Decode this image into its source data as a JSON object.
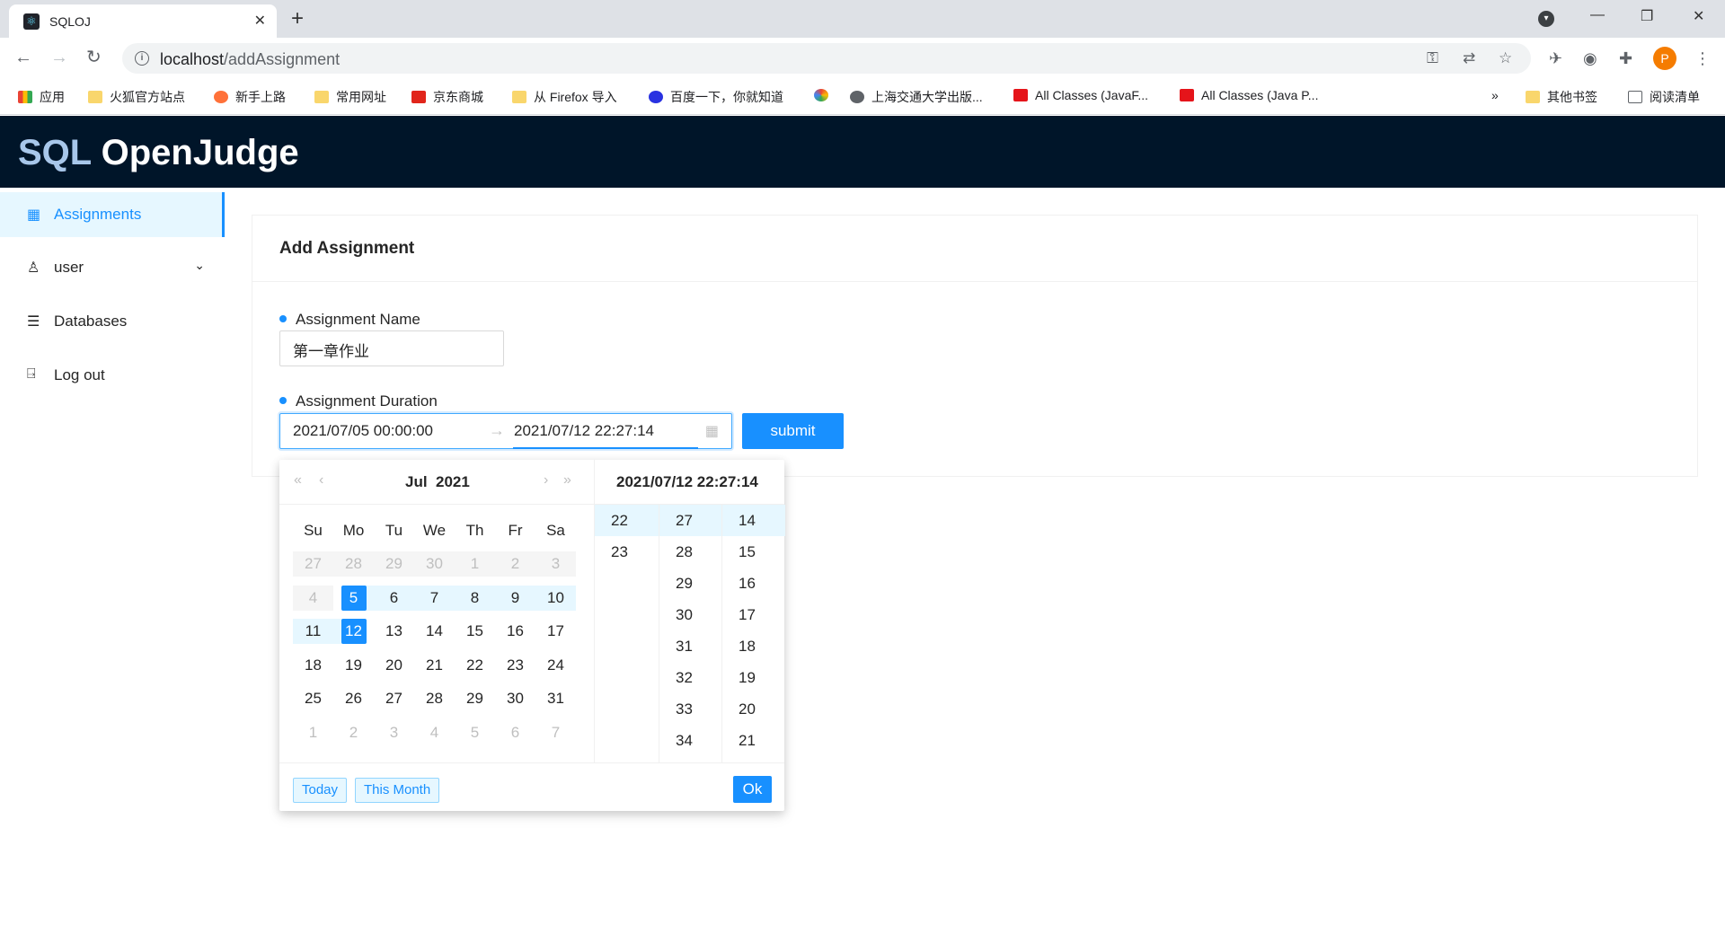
{
  "browser": {
    "tab_title": "SQLOJ",
    "url_host": "localhost",
    "url_path": "/addAssignment",
    "profile_initial": "P",
    "bookmarks": [
      {
        "label": "应用"
      },
      {
        "label": "火狐官方站点"
      },
      {
        "label": "新手上路"
      },
      {
        "label": "常用网址"
      },
      {
        "label": "京东商城"
      },
      {
        "label": "从 Firefox 导入"
      },
      {
        "label": "百度一下，你就知道"
      },
      {
        "label": "上海交通大学出版..."
      },
      {
        "label": "All Classes (JavaF..."
      },
      {
        "label": "All Classes (Java P..."
      },
      {
        "label": "其他书签"
      },
      {
        "label": "阅读清单"
      }
    ],
    "more_bookmarks": "»"
  },
  "app": {
    "logo_sql": "SQL",
    "logo_rest": " OpenJudge"
  },
  "sidebar": {
    "items": [
      {
        "label": "Assignments"
      },
      {
        "label": "user"
      },
      {
        "label": "Databases"
      },
      {
        "label": "Log out"
      }
    ]
  },
  "form": {
    "title": "Add Assignment",
    "name_label": "Assignment Name",
    "name_value": "第一章作业",
    "duration_label": "Assignment Duration",
    "start_value": "2021/07/05 00:00:00",
    "end_value": "2021/07/12 22:27:14",
    "submit_label": "submit"
  },
  "picker": {
    "month": "Jul",
    "year": "2021",
    "weekdays": [
      "Su",
      "Mo",
      "Tu",
      "We",
      "Th",
      "Fr",
      "Sa"
    ],
    "weeks": [
      [
        "27",
        "28",
        "29",
        "30",
        "1",
        "2",
        "3"
      ],
      [
        "4",
        "5",
        "6",
        "7",
        "8",
        "9",
        "10"
      ],
      [
        "11",
        "12",
        "13",
        "14",
        "15",
        "16",
        "17"
      ],
      [
        "18",
        "19",
        "20",
        "21",
        "22",
        "23",
        "24"
      ],
      [
        "25",
        "26",
        "27",
        "28",
        "29",
        "30",
        "31"
      ],
      [
        "1",
        "2",
        "3",
        "4",
        "5",
        "6",
        "7"
      ]
    ],
    "time_title": "2021/07/12 22:27:14",
    "hours": [
      "22",
      "23"
    ],
    "minutes": [
      "27",
      "28",
      "29",
      "30",
      "31",
      "32",
      "33",
      "34"
    ],
    "seconds": [
      "14",
      "15",
      "16",
      "17",
      "18",
      "19",
      "20",
      "21"
    ],
    "today_label": "Today",
    "this_month_label": "This Month",
    "ok_label": "Ok"
  }
}
